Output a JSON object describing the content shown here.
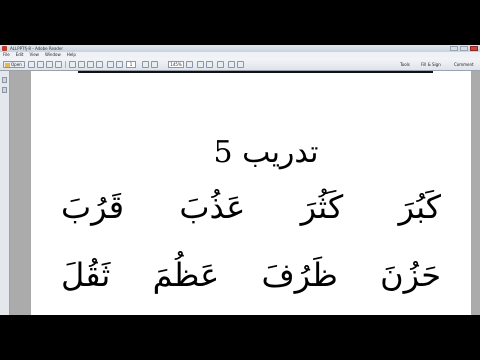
{
  "window": {
    "title": "ALLPPTfj-8 - Adobe Reader"
  },
  "menu": [
    "File",
    "Edit",
    "View",
    "Window",
    "Help"
  ],
  "toolbar": {
    "open_label": "Open",
    "page_number": "1",
    "zoom": "145%",
    "right_links": [
      "Tools",
      "Fill & Sign",
      "Comment"
    ]
  },
  "document": {
    "title": "تدريب 5",
    "row1": [
      "كَبُرَ",
      "كَثُرَ",
      "عَذُبَ",
      "قَرُبَ"
    ],
    "row2": [
      "حَزُنَ",
      "ظَرُفَ",
      "عَظُمَ",
      "ثَقُلَ"
    ]
  },
  "colors": {
    "titlebar": "#c8d2de",
    "page": "#ffffff",
    "viewer_bg": "#ababab",
    "letterbox": "#000000"
  }
}
